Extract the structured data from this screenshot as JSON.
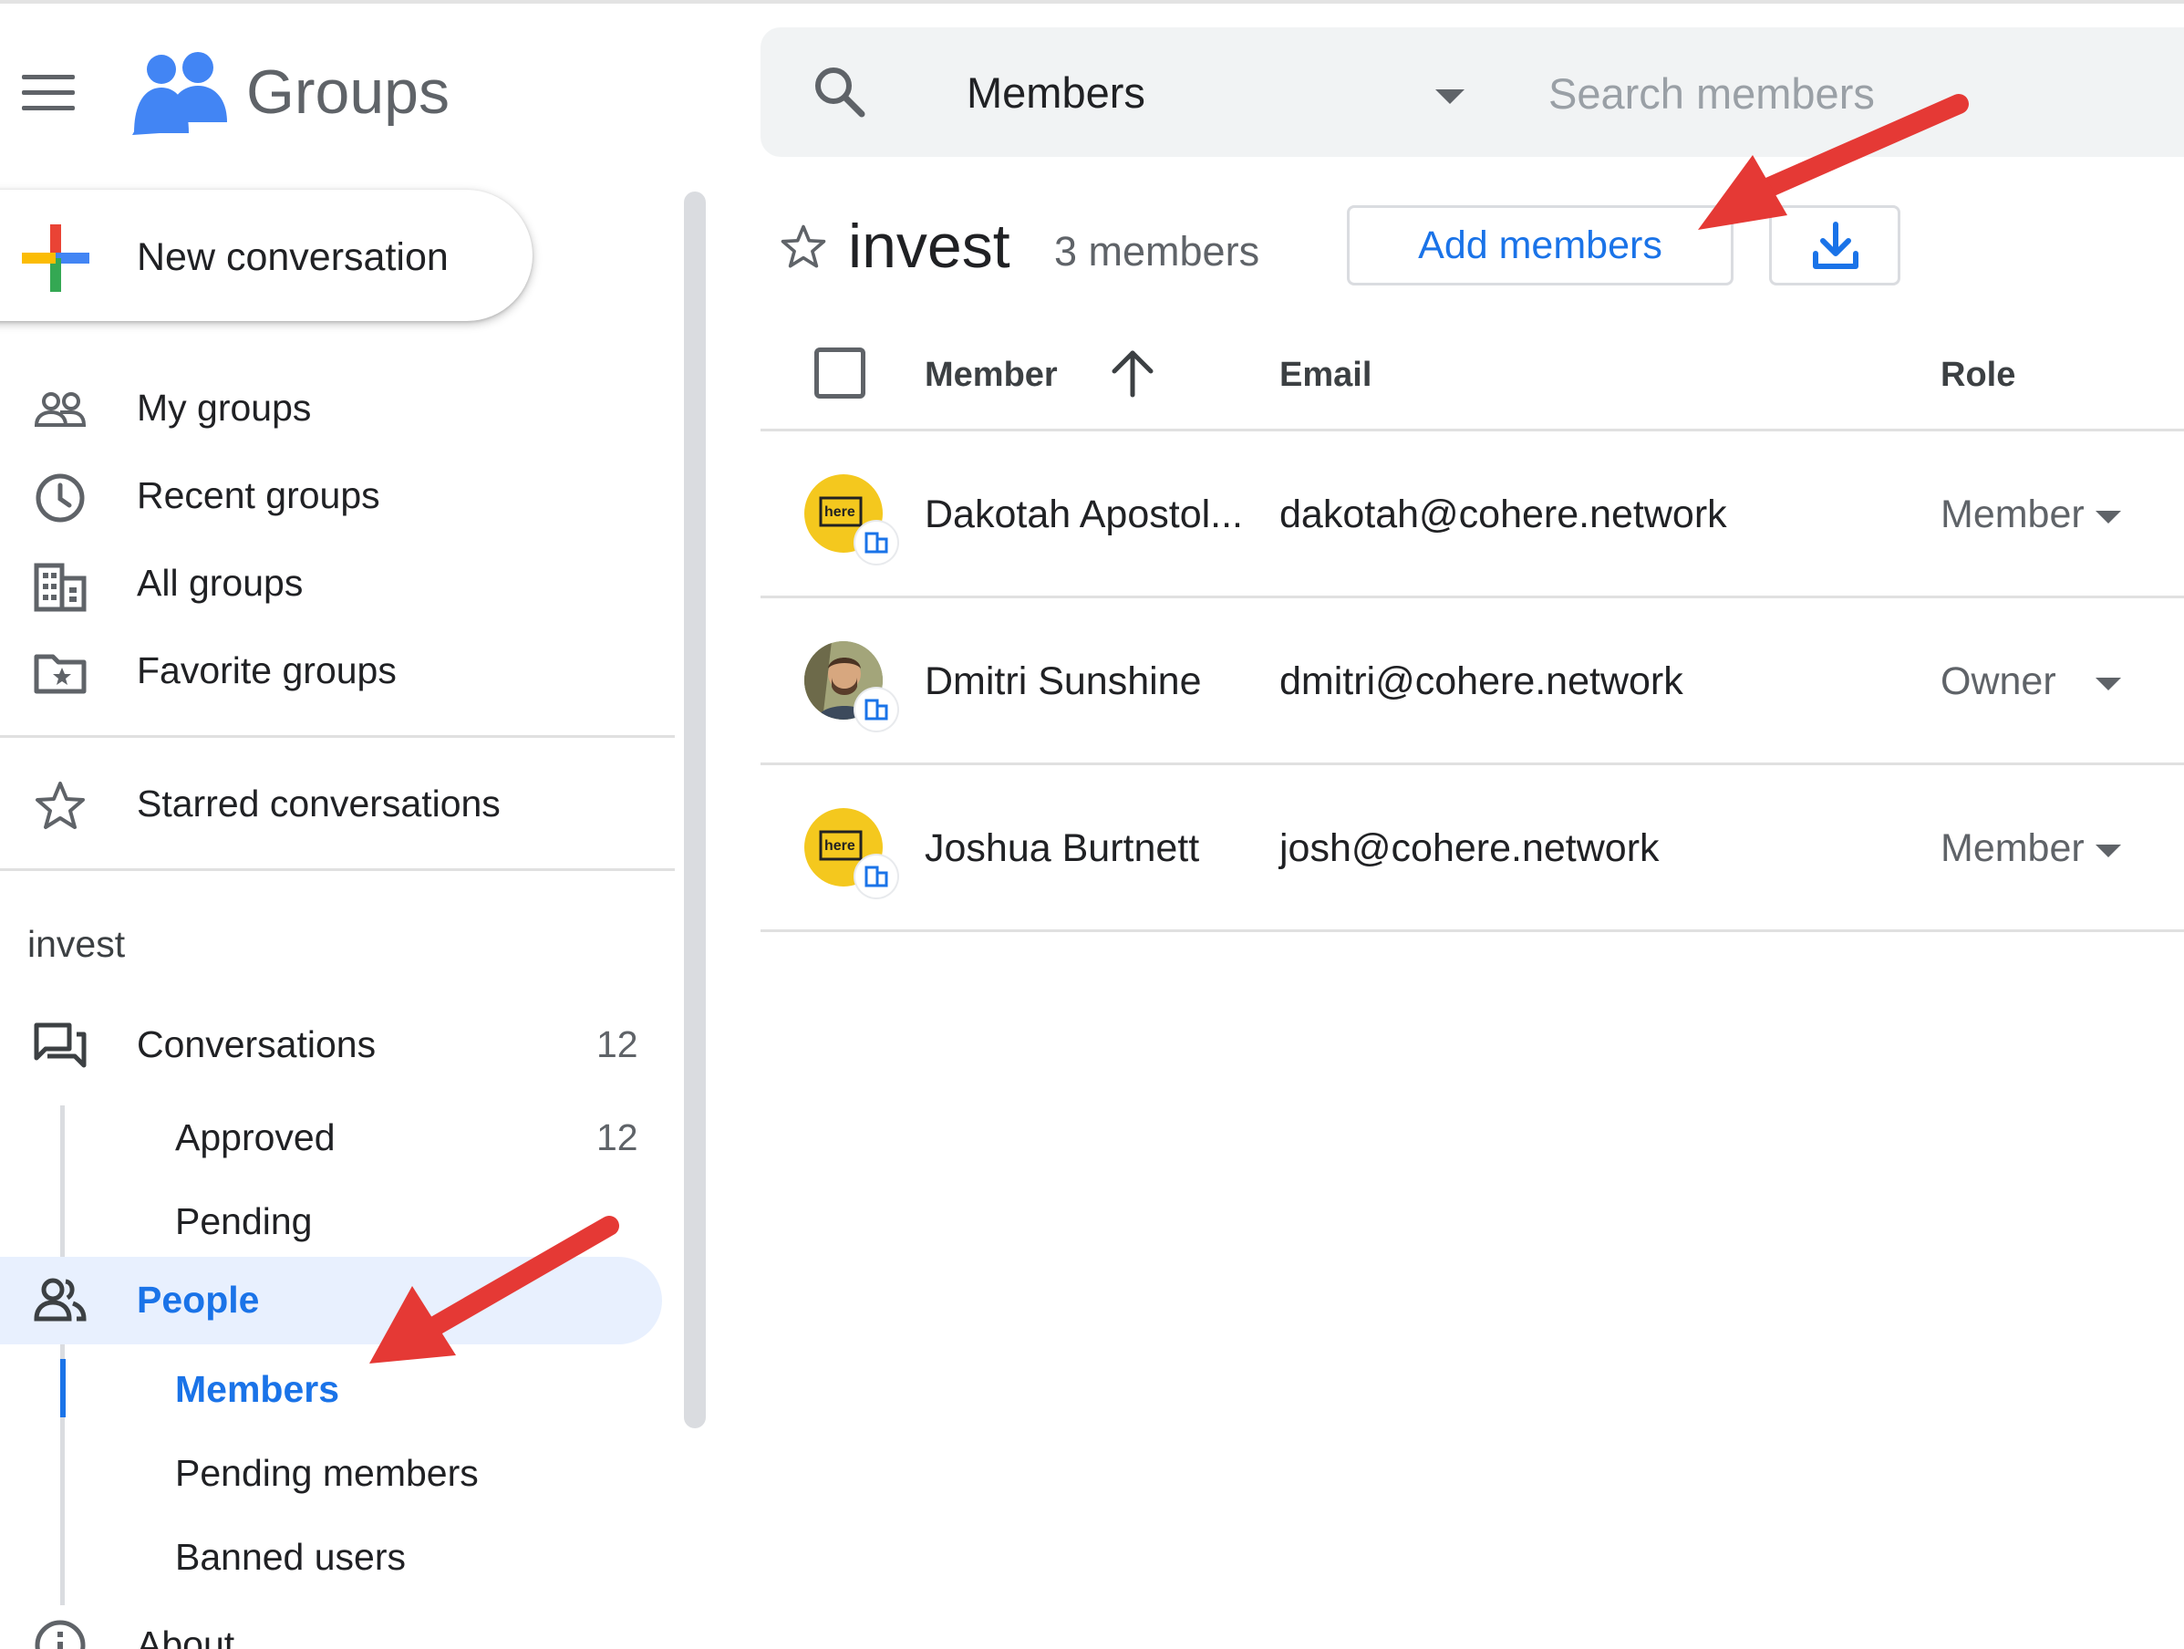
{
  "app": {
    "title": "Groups"
  },
  "search": {
    "scope": "Members",
    "placeholder": "Search members"
  },
  "compose": {
    "label": "New conversation"
  },
  "nav": {
    "items": [
      {
        "label": "My groups",
        "icon": "people-outline-icon"
      },
      {
        "label": "Recent groups",
        "icon": "clock-icon"
      },
      {
        "label": "All groups",
        "icon": "building-icon"
      },
      {
        "label": "Favorite groups",
        "icon": "folder-star-icon"
      }
    ],
    "starred": {
      "label": "Starred conversations",
      "icon": "star-outline-icon"
    }
  },
  "group_nav": {
    "title": "invest",
    "conversations": {
      "label": "Conversations",
      "count": "12"
    },
    "approved": {
      "label": "Approved",
      "count": "12"
    },
    "pending": {
      "label": "Pending"
    },
    "people": {
      "label": "People"
    },
    "members": {
      "label": "Members"
    },
    "pending_members": {
      "label": "Pending members"
    },
    "banned_users": {
      "label": "Banned users"
    },
    "about": {
      "label": "About"
    }
  },
  "main": {
    "group_title": "invest",
    "member_count": "3 members",
    "add_members_label": "Add members",
    "table": {
      "columns": {
        "member": "Member",
        "email": "Email",
        "role": "Role"
      },
      "rows": [
        {
          "name": "Dakotah Apostol...",
          "email": "dakotah@cohere.network",
          "role": "Member",
          "avatar": "here-logo"
        },
        {
          "name": "Dmitri Sunshine",
          "email": "dmitri@cohere.network",
          "role": "Owner",
          "avatar": "photo"
        },
        {
          "name": "Joshua Burtnett",
          "email": "josh@cohere.network",
          "role": "Member",
          "avatar": "here-logo"
        }
      ]
    }
  },
  "colors": {
    "accent": "#1a73e8",
    "active_bg": "#e8f0fe",
    "annotation_arrow": "#e53935"
  }
}
